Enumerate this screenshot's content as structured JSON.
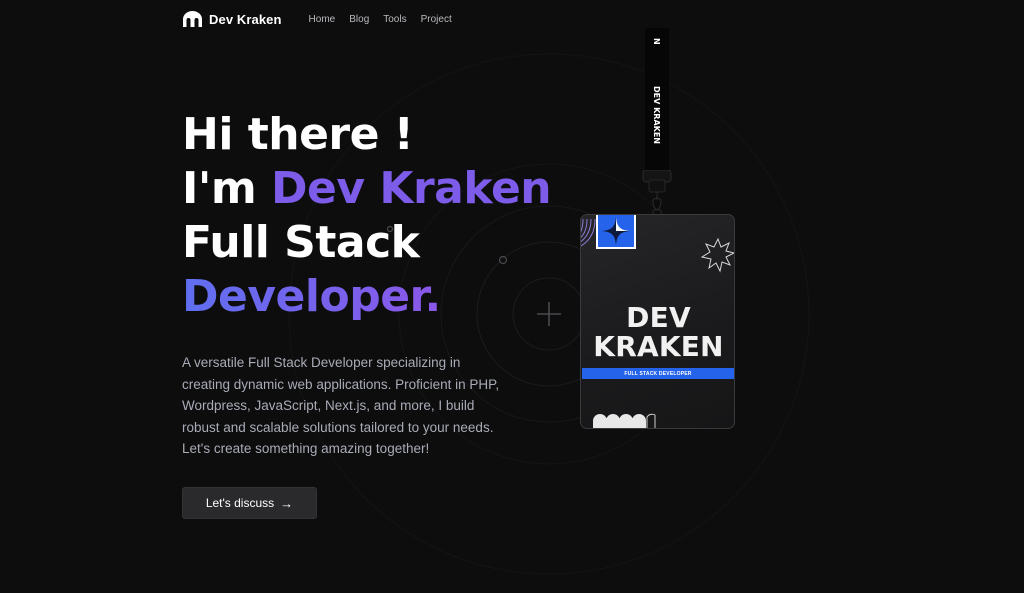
{
  "nav": {
    "brand": "Dev Kraken",
    "links": [
      "Home",
      "Blog",
      "Tools",
      "Project"
    ]
  },
  "hero": {
    "line1": "Hi there !",
    "line2_prefix": "I'm ",
    "line2_name": "Dev Kraken",
    "line3": "Full Stack",
    "line4": "Developer."
  },
  "description": "A versatile Full Stack Developer specializing in creating dynamic web applications. Proficient in PHP, Wordpress, JavaScript, Next.js, and more, I build robust and scalable solutions tailored to your needs. Let's create something amazing together!",
  "cta": {
    "label": "Let's discuss",
    "arrow": "→"
  },
  "badge": {
    "strap_text": "DEV KRAKEN",
    "strap_mark": "N",
    "title_line1": "DEV",
    "title_line2": "KRAKEN",
    "subtitle": "FULL STACK DEVELOPER"
  },
  "colors": {
    "background": "#0d0d0e",
    "accent": "#7c5ce8",
    "badge_blue": "#2563eb",
    "button_bg": "#2a2a2d"
  },
  "icons": {
    "brand_logo": "kraken-arch-icon",
    "cta_arrow": "arrow-right-icon",
    "crosshair": "plus-icon",
    "badge_star": "sparkle-star-icon",
    "badge_burst": "starburst-icon"
  }
}
